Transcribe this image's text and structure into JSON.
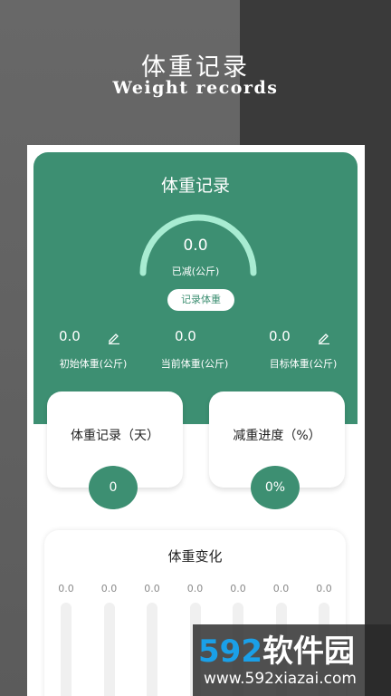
{
  "promo": {
    "title": "体重记录",
    "subtitle": "Weight records"
  },
  "hero": {
    "title": "体重记录",
    "gauge_value": "0.0",
    "gauge_label": "已减(公斤)",
    "record_button": "记录体重",
    "stats": [
      {
        "value": "0.0",
        "label": "初始体重(公斤)"
      },
      {
        "value": "0.0",
        "label": "当前体重(公斤)"
      },
      {
        "value": "0.0",
        "label": "目标体重(公斤)"
      }
    ]
  },
  "cards": [
    {
      "title": "体重记录（天）",
      "value": "0"
    },
    {
      "title": "减重进度（%）",
      "value": "0%"
    }
  ],
  "chart": {
    "title": "体重变化"
  },
  "chart_data": {
    "type": "bar",
    "title": "体重变化",
    "categories": [
      "",
      "",
      "",
      "",
      "",
      "",
      ""
    ],
    "values": [
      0.0,
      0.0,
      0.0,
      0.0,
      0.0,
      0.0,
      0.0
    ],
    "value_labels": [
      "0.0",
      "0.0",
      "0.0",
      "0.0",
      "0.0",
      "0.0",
      "0.0"
    ],
    "ylim": [
      0,
      1
    ],
    "grid": false
  },
  "watermark": {
    "logo_num": "592",
    "logo_cn": "软件园",
    "url": "www.592xiazai.com"
  },
  "colors": {
    "accent": "#3d8f72",
    "gauge_arc": "#a8ecd2",
    "watermark_blue": "#1aa0e8"
  }
}
